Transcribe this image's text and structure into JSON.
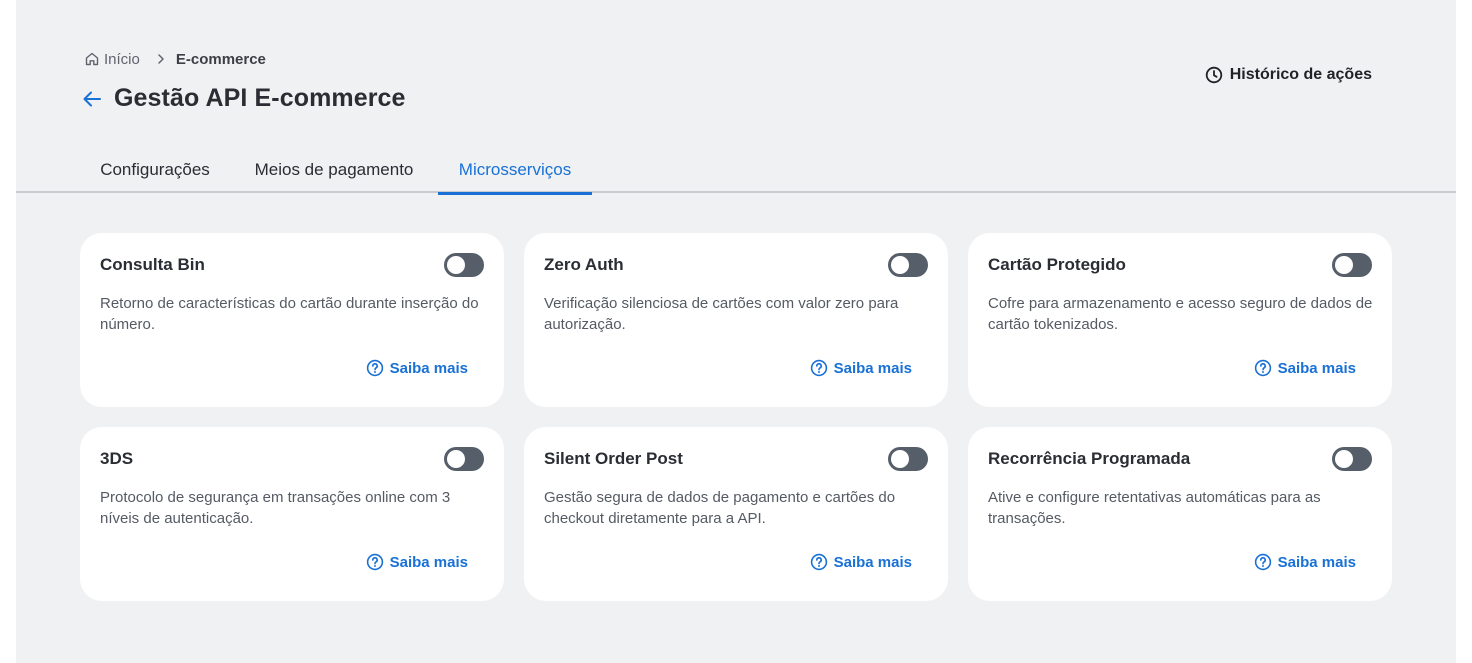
{
  "breadcrumb": {
    "home": "Início",
    "current": "E-commerce"
  },
  "header": {
    "title": "Gestão API E-commerce",
    "history_label": "Histórico de ações"
  },
  "tabs": [
    {
      "label": "Configurações",
      "active": false
    },
    {
      "label": "Meios de pagamento",
      "active": false
    },
    {
      "label": "Microsserviços",
      "active": true
    }
  ],
  "cards": [
    {
      "title": "Consulta Bin",
      "description": "Retorno de características do cartão durante inserção do número.",
      "link": "Saiba mais",
      "enabled": false
    },
    {
      "title": "Zero Auth",
      "description": "Verificação silenciosa de cartões com valor zero para autorização.",
      "link": "Saiba mais",
      "enabled": false
    },
    {
      "title": "Cartão Protegido",
      "description": "Cofre para armazenamento e acesso seguro de dados de cartão tokenizados.",
      "link": "Saiba mais",
      "enabled": false
    },
    {
      "title": "3DS",
      "description": "Protocolo de segurança em transações online com 3 níveis de autenticação.",
      "link": "Saiba mais",
      "enabled": false
    },
    {
      "title": "Silent Order Post",
      "description": "Gestão segura de dados de pagamento e cartões do checkout diretamente para a API.",
      "link": "Saiba mais",
      "enabled": false
    },
    {
      "title": "Recorrência Programada",
      "description": "Ative e configure retentativas automáticas para as transações.",
      "link": "Saiba mais",
      "enabled": false
    }
  ],
  "colors": {
    "accent": "#1971d6",
    "background": "#f0f1f3",
    "toggle_off": "#565e6a"
  },
  "icons": {
    "home": "home-icon",
    "chevron": "chevron-right-icon",
    "back": "arrow-left-icon",
    "history": "clock-icon",
    "help": "question-circle-icon"
  }
}
